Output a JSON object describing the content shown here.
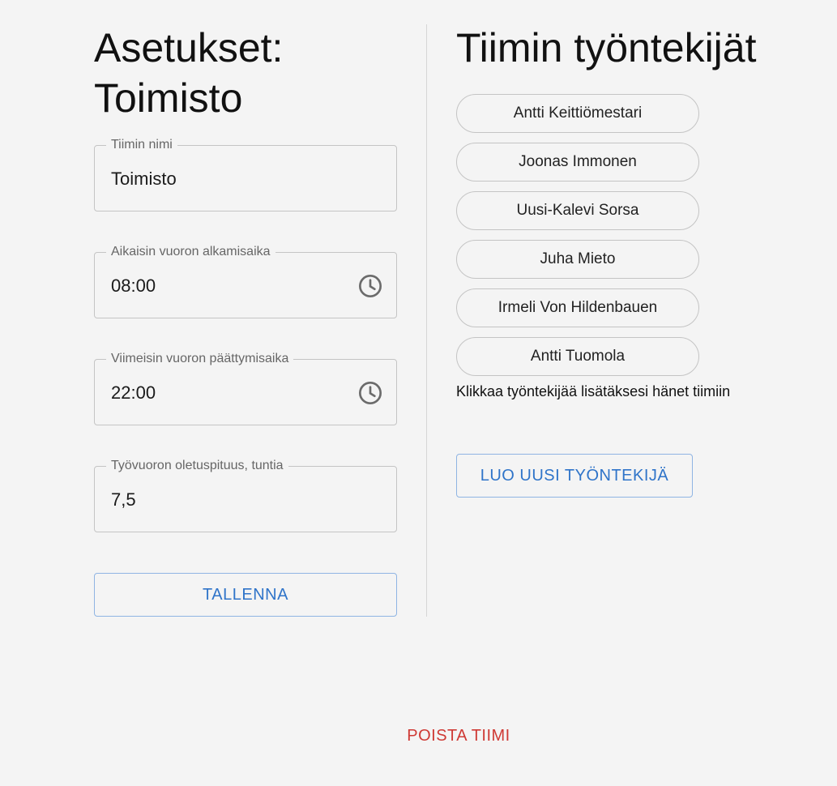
{
  "settings": {
    "heading_line1": "Asetukset:",
    "heading_line2": "Toimisto",
    "fields": [
      {
        "label": "Tiimin nimi",
        "value": "Toimisto"
      },
      {
        "label": "Aikaisin vuoron alkamisaika",
        "value": "08:00",
        "icon": "clock-icon"
      },
      {
        "label": "Viimeisin vuoron päättymisaika",
        "value": "22:00",
        "icon": "clock-icon"
      },
      {
        "label": "Työvuoron oletuspituus, tuntia",
        "value": "7,5"
      }
    ],
    "save_label": "TALLENNA"
  },
  "team": {
    "heading": "Tiimin työntekijät",
    "employees": [
      "Antti Keittiömestari",
      "Joonas Immonen",
      "Uusi-Kalevi Sorsa",
      "Juha Mieto",
      "Irmeli Von Hildenbauen",
      "Antti Tuomola"
    ],
    "hint": "Klikkaa työntekijää lisätäksesi hänet tiimiin",
    "create_label": "LUO UUSI TYÖNTEKIJÄ"
  },
  "delete_label": "POISTA TIIMI",
  "colors": {
    "background": "#f4f4f4",
    "accent": "#2f74c9",
    "danger": "#cf3a35",
    "border": "#c4c4c4"
  }
}
